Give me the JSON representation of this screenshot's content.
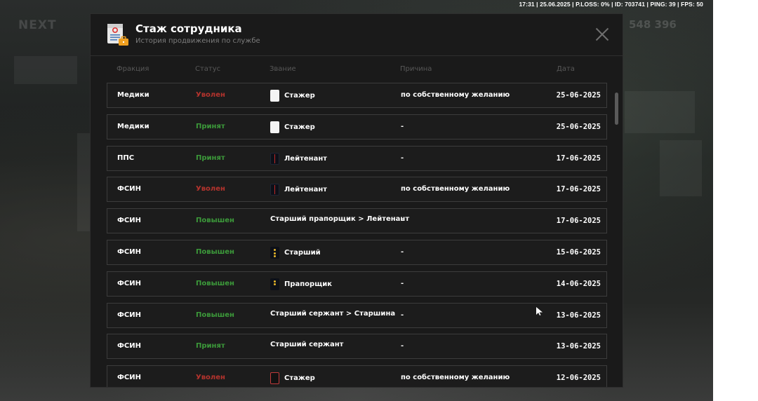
{
  "hud": {
    "status_line": "17:31 | 25.06.2025 | P.LOSS: 0% | ID: 703741 | PING: 39 | FPS: 50",
    "logo": "NEXT",
    "money": "548 396"
  },
  "modal": {
    "title": "Стаж сотрудника",
    "subtitle": "История продвижения по службе",
    "icon": "document-suitcase-icon",
    "close_icon": "close-icon"
  },
  "columns": {
    "faction": "Фракция",
    "status": "Статус",
    "rank": "Звание",
    "reason": "Причина",
    "date": "Дата"
  },
  "rows": [
    {
      "faction": "Медики",
      "status": "Уволен",
      "status_kind": "fired",
      "badge": "white",
      "rank": "Стажер",
      "reason": "по собственному желанию",
      "date": "25-06-2025"
    },
    {
      "faction": "Медики",
      "status": "Принят",
      "status_kind": "ok",
      "badge": "white",
      "rank": "Стажер",
      "reason": "-",
      "date": "25-06-2025"
    },
    {
      "faction": "ППС",
      "status": "Принят",
      "status_kind": "ok",
      "badge": "strap",
      "rank": "Лейтенант",
      "reason": "-",
      "date": "17-06-2025"
    },
    {
      "faction": "ФСИН",
      "status": "Уволен",
      "status_kind": "fired",
      "badge": "strap",
      "rank": "Лейтенант",
      "reason": "по собственному желанию",
      "date": "17-06-2025"
    },
    {
      "faction": "ФСИН",
      "status": "Повышен",
      "status_kind": "ok",
      "badge": "none",
      "rank": "Старший прапорщик > Лейтенант",
      "reason": "-",
      "date": "17-06-2025"
    },
    {
      "faction": "ФСИН",
      "status": "Повышен",
      "status_kind": "ok",
      "badge": "star",
      "rank": "Старший",
      "reason": "-",
      "date": "15-06-2025"
    },
    {
      "faction": "ФСИН",
      "status": "Повышен",
      "status_kind": "ok",
      "badge": "star",
      "rank": "Прапорщик",
      "reason": "-",
      "date": "14-06-2025"
    },
    {
      "faction": "ФСИН",
      "status": "Повышен",
      "status_kind": "ok",
      "badge": "none",
      "rank": "Старший сержант > Старшина",
      "reason": "-",
      "date": "13-06-2025"
    },
    {
      "faction": "ФСИН",
      "status": "Принят",
      "status_kind": "ok",
      "badge": "none",
      "rank": "Старший сержант",
      "reason": "-",
      "date": "13-06-2025"
    },
    {
      "faction": "ФСИН",
      "status": "Уволен",
      "status_kind": "fired",
      "badge": "outline",
      "rank": "Стажер",
      "reason": "по собственному желанию",
      "date": "12-06-2025"
    }
  ],
  "colors": {
    "fired": "#b4332d",
    "ok": "#3c9a3a",
    "panel": "#1a1a1a"
  }
}
